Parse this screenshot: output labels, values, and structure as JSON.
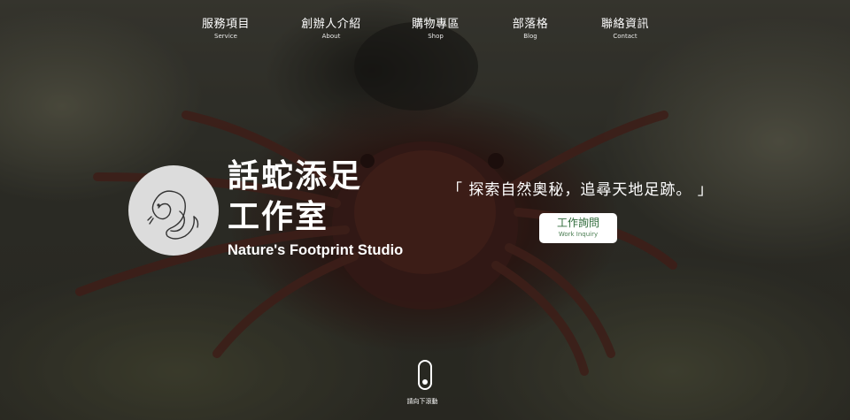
{
  "nav": {
    "items": [
      {
        "zh": "服務項目",
        "en": "Service"
      },
      {
        "zh": "創辦人介紹",
        "en": "About"
      },
      {
        "zh": "購物專區",
        "en": "Shop"
      },
      {
        "zh": "部落格",
        "en": "Blog"
      },
      {
        "zh": "聯絡資訊",
        "en": "Contact"
      }
    ]
  },
  "brand": {
    "name_zh_line1": "話蛇添足",
    "name_zh_line2": "工作室",
    "name_en": "Nature's Footprint Studio",
    "logo_icon": "snake-sketch-icon"
  },
  "hero": {
    "tagline": "「 探索自然奧秘，追尋天地足跡。 」",
    "cta_zh": "工作詢問",
    "cta_en": "Work Inquiry",
    "scroll_label": "請向下滾動",
    "scroll_icon": "mouse-scroll-icon"
  },
  "colors": {
    "cta_text": "#2f6b3a",
    "logo_bg": "#dcdcdc"
  }
}
